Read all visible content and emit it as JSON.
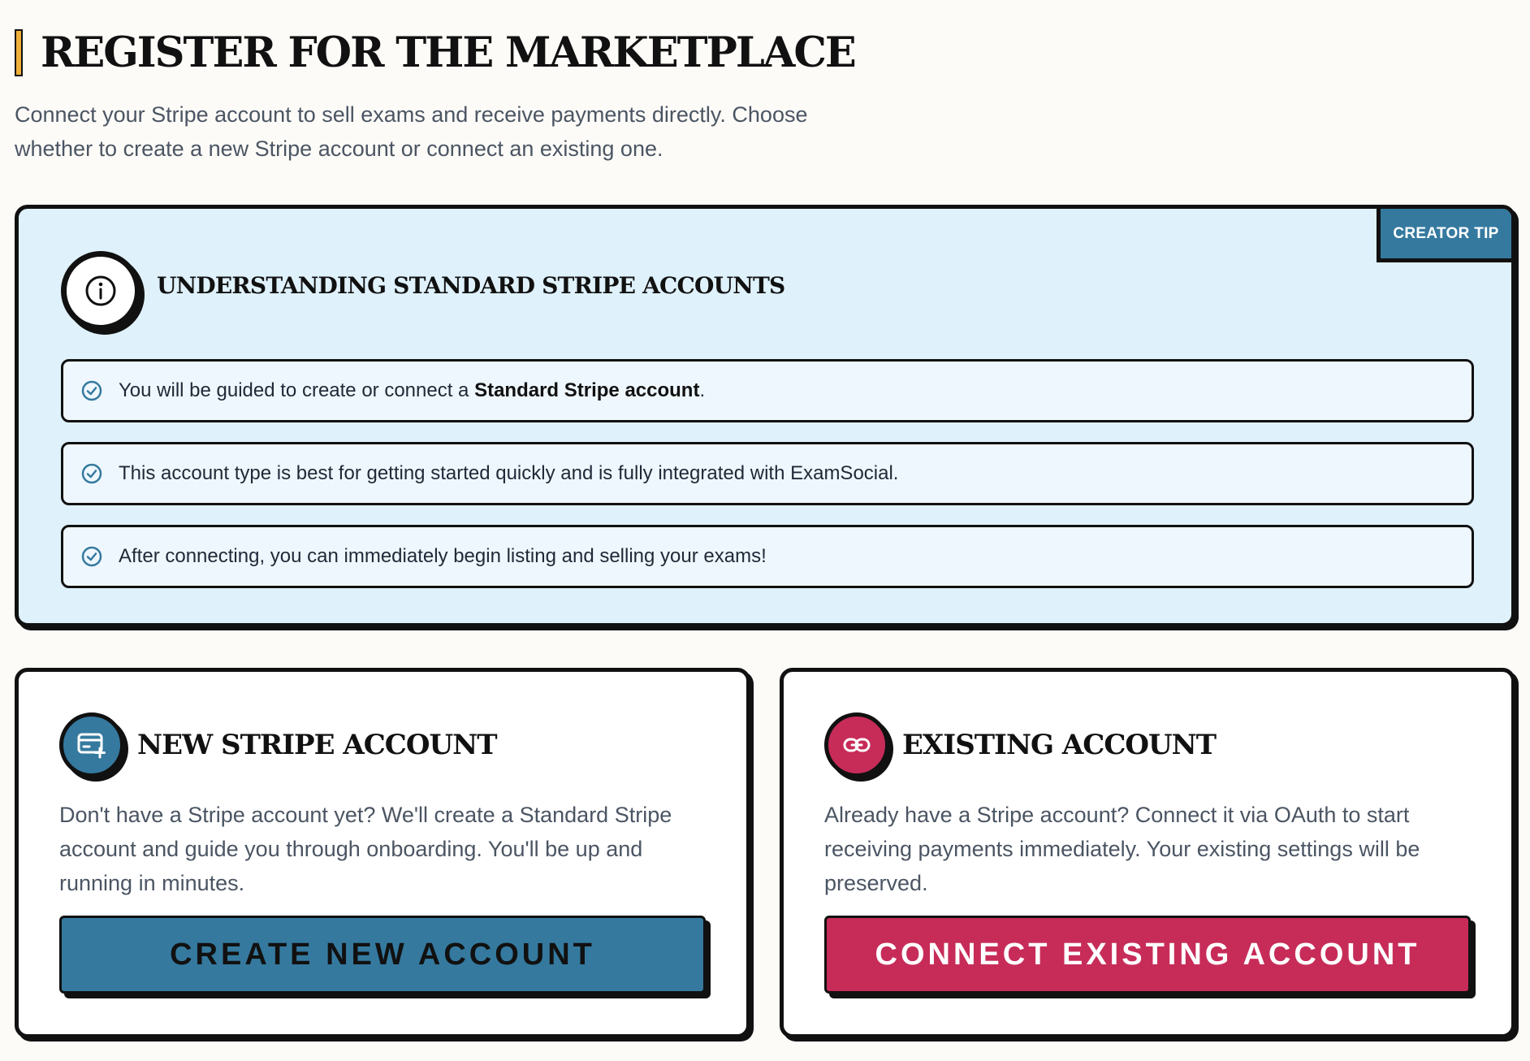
{
  "header": {
    "title": "REGISTER FOR THE MARKETPLACE",
    "subtitle": "Connect your Stripe account to sell exams and receive payments directly. Choose whether to create a new Stripe account or connect an existing one."
  },
  "tip": {
    "badge": "CREATOR TIP",
    "title": "UNDERSTANDING STANDARD STRIPE ACCOUNTS",
    "items": [
      {
        "text_before": "You will be guided to create or connect a ",
        "text_bold": "Standard Stripe account",
        "text_after": "."
      },
      {
        "text": "This account type is best for getting started quickly and is fully integrated with ExamSocial."
      },
      {
        "text": "After connecting, you can immediately begin listing and selling your exams!"
      }
    ]
  },
  "new_account": {
    "title": "NEW STRIPE ACCOUNT",
    "description": "Don't have a Stripe account yet? We'll create a Standard Stripe account and guide you through onboarding. You'll be up and running in minutes.",
    "button": "CREATE NEW ACCOUNT",
    "icon": "card-add-icon"
  },
  "existing_account": {
    "title": "EXISTING ACCOUNT",
    "description": "Already have a Stripe account? Connect it via OAuth to start receiving payments immediately. Your existing settings will be preserved.",
    "button": "CONNECT EXISTING ACCOUNT",
    "icon": "link-icon"
  },
  "colors": {
    "background": "#fcfbf7",
    "accent_yellow": "#f0b03a",
    "tip_background": "#dff1fb",
    "blue": "#35799f",
    "red": "#c72c59"
  }
}
